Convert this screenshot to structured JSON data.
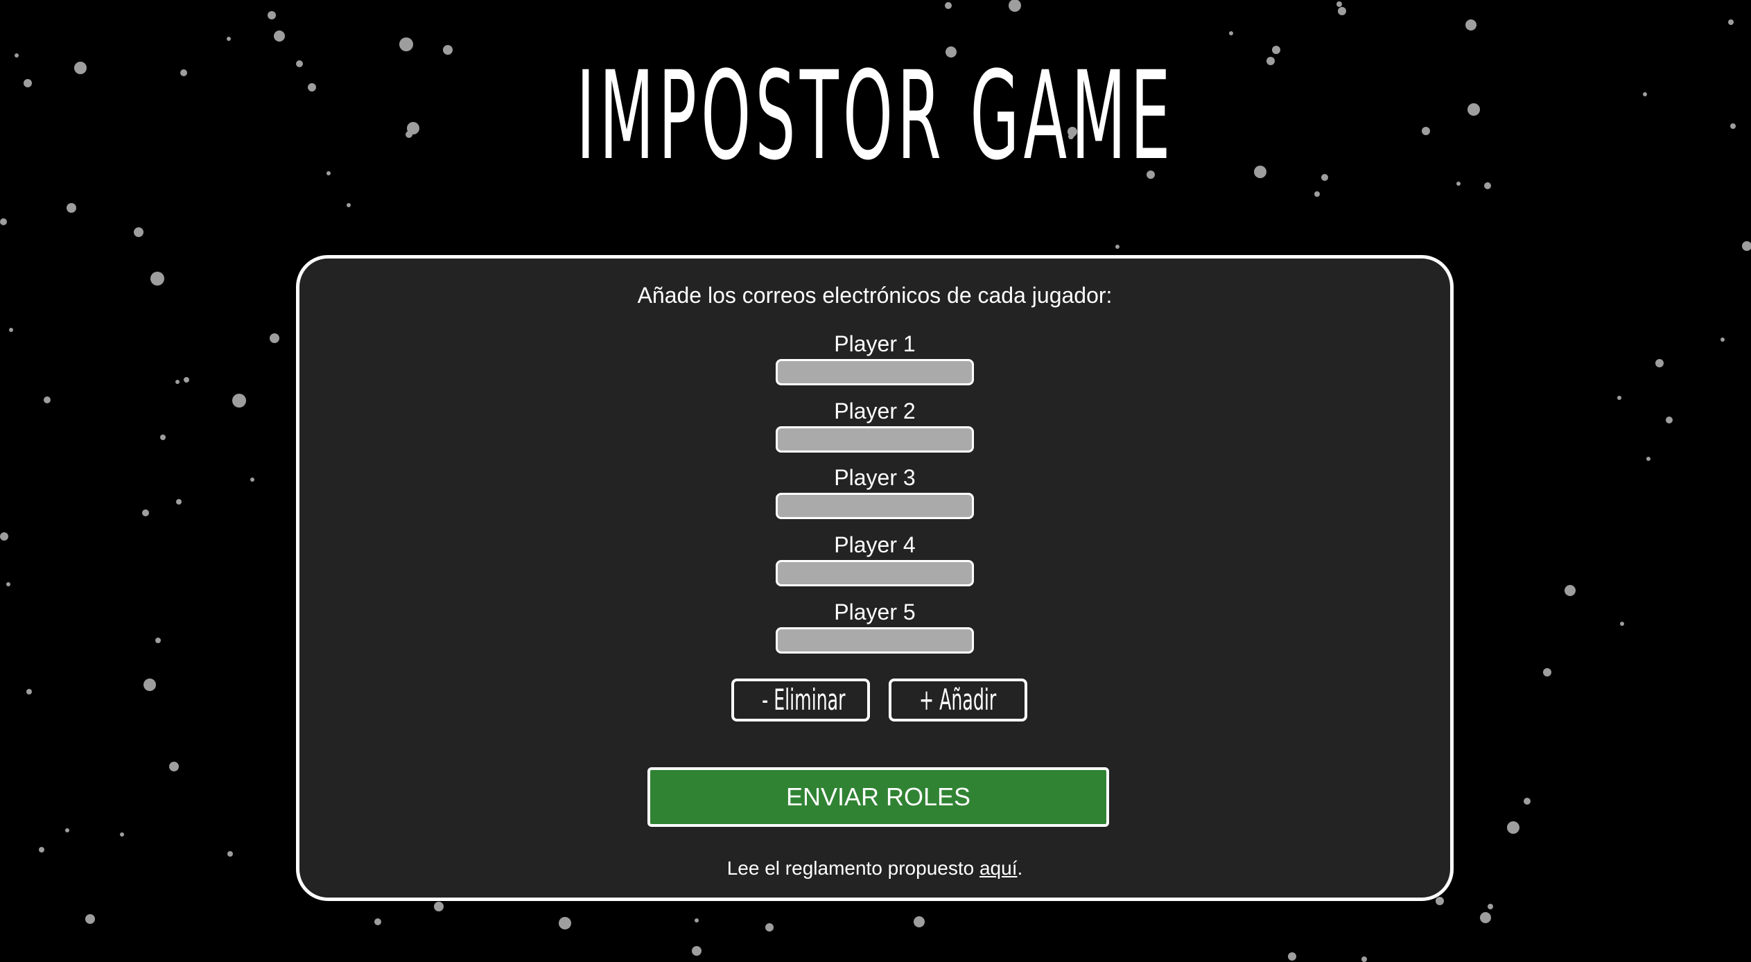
{
  "title": "IMPOSTOR GAME",
  "form": {
    "instructions": "Añade los correos electrónicos de cada jugador:",
    "players": [
      {
        "label": "Player 1",
        "value": ""
      },
      {
        "label": "Player 2",
        "value": ""
      },
      {
        "label": "Player 3",
        "value": ""
      },
      {
        "label": "Player 4",
        "value": ""
      },
      {
        "label": "Player 5",
        "value": ""
      }
    ],
    "remove_label": "- Eliminar",
    "add_label": "+ Añadir",
    "send_label": "ENVIAR ROLES",
    "rules_prefix": "Lee el reglamento propuesto ",
    "rules_link": "aquí",
    "rules_suffix": "."
  },
  "colors": {
    "background": "#000000",
    "panel": "#232323",
    "input": "#aaaaaa",
    "send_button": "#318334",
    "star": "#9e9e9e",
    "text": "#ffffff"
  }
}
